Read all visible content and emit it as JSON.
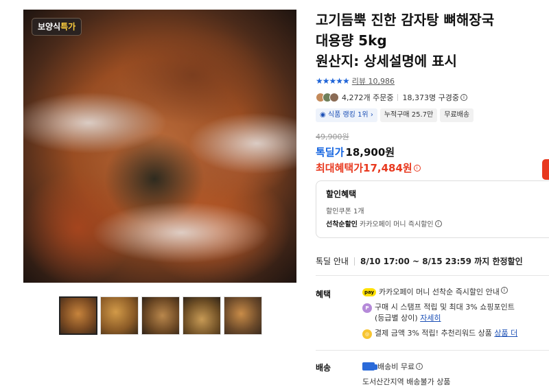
{
  "product": {
    "badge": {
      "prefix": "보양식",
      "highlight": "특가"
    },
    "title_lines": [
      "고기듬뿍 진한 감자탕 뼈해장국",
      "대용량 5kg",
      "원산지: 상세설명에 표시"
    ],
    "rating": {
      "stars": 5,
      "review_label": "리뷰",
      "review_count": "10,986"
    },
    "stats": {
      "orders": "4,272개 주문중",
      "subscribers": "18,373명 구경중"
    },
    "tags": [
      "식품 랭킹 1위",
      "누적구매 25.7만",
      "무료배송"
    ]
  },
  "price": {
    "original": "49,900원",
    "sale_label": "톡딜가",
    "sale_price": "18,900원",
    "max_label": "최대혜택가",
    "max_price": "17,484원"
  },
  "discount": {
    "header": "할인혜택",
    "coupon": "할인쿠폰 1개",
    "first_label": "선착순할인",
    "first_text": "카카오페이 머니 즉시할인"
  },
  "deal": {
    "label": "톡딜 안내",
    "period": "8/10 17:00 ~ 8/15 23:59 까지 한정할인"
  },
  "benefits": {
    "label": "혜택",
    "items": [
      {
        "icon": "pay",
        "text": "카카오페이 머니 선착순 즉시할인 안내"
      },
      {
        "icon": "point",
        "line1": "구매 시 스탬프 적립 및 최대 3% 쇼핑포인트",
        "line2": "(등급별 상이)",
        "link": "자세히"
      },
      {
        "icon": "coin",
        "text": "결제 금액 3% 적립! 추천리워드 상품",
        "link": "상품 더"
      }
    ]
  },
  "shipping": {
    "label": "배송",
    "fee": "배송비 무료",
    "note": "도서산간지역 배송불가 상품"
  },
  "icons": {
    "badge_small_pay": "pay",
    "colors": {
      "accent_blue": "#1565e0",
      "accent_red": "#e8391f",
      "kakao_yellow": "#ffe000"
    }
  }
}
